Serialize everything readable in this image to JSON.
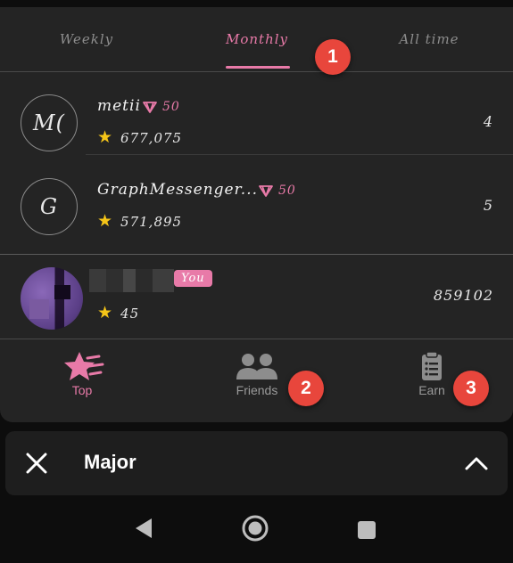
{
  "tabs": [
    {
      "label": "Weekly",
      "active": false
    },
    {
      "label": "Monthly",
      "active": true
    },
    {
      "label": "All time",
      "active": false
    }
  ],
  "annotations": [
    "1",
    "2",
    "3"
  ],
  "leaderboard": [
    {
      "initials": "M(",
      "name": "metii",
      "points": "50",
      "score": "677,075",
      "rank": "4"
    },
    {
      "initials": "G",
      "name": "GraphMessenger...",
      "points": "50",
      "score": "571,895",
      "rank": "5"
    }
  ],
  "me": {
    "tag": "You",
    "score": "45",
    "rank": "859102"
  },
  "nav": {
    "top": "Top",
    "friends": "Friends",
    "earn": "Earn"
  },
  "mini_app": {
    "title": "Major"
  },
  "colors": {
    "accent": "#e87aa8",
    "star": "#f5c518",
    "badge": "#e8463c",
    "panel": "#242424"
  },
  "icons": {
    "star": "star-icon",
    "points": "gem-icon",
    "top": "top-star-icon",
    "friends": "friends-icon",
    "earn": "clipboard-icon"
  }
}
